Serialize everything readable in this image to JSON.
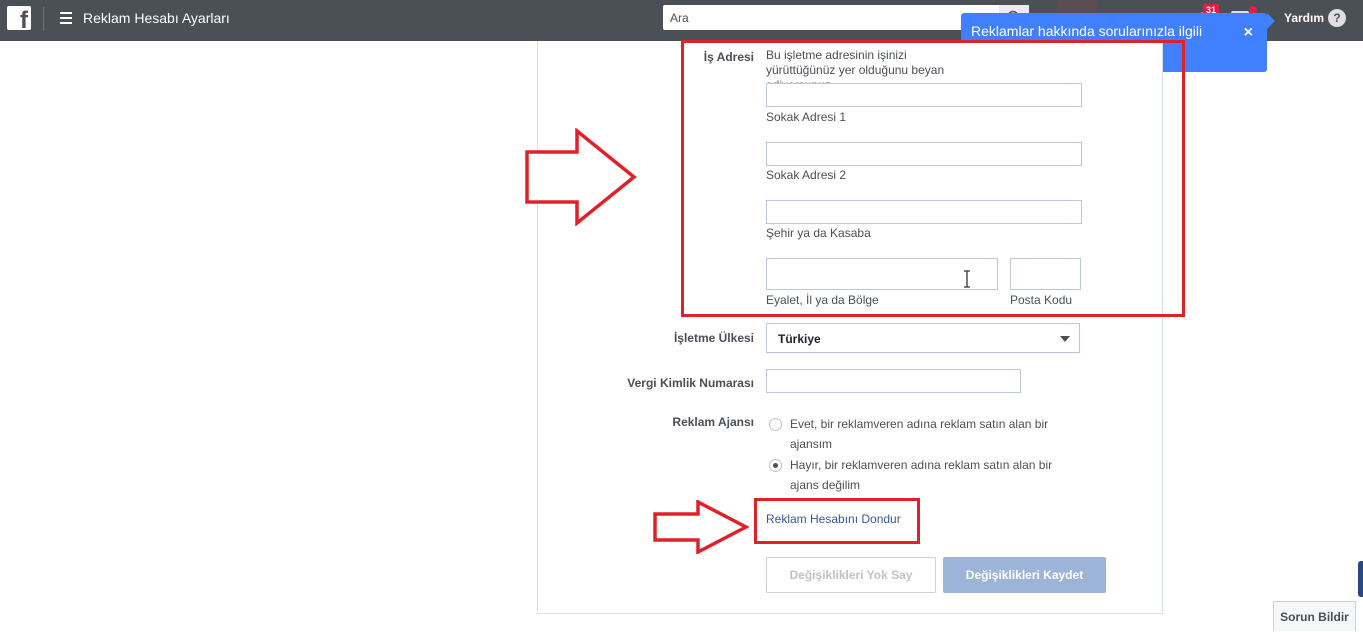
{
  "topbar": {
    "title": "Reklam Hesabı Ayarları",
    "search_placeholder": "Ara",
    "notif_badge": "31",
    "help_label": "Yardım",
    "help_icon": "?"
  },
  "tooltip": {
    "text": "Reklamlar hakkında sorularınızla ilgili yardım alın.",
    "close": "×"
  },
  "form": {
    "address_label": "İş Adresi",
    "address_help": "Bu işletme adresinin işinizi yürüttüğünüz yer olduğunu beyan ediyorsunuz.",
    "street1_caption": "Sokak Adresi 1",
    "street2_caption": "Sokak Adresi 2",
    "city_caption": "Şehir ya da Kasaba",
    "state_caption": "Eyalet, İl ya da Bölge",
    "zip_caption": "Posta Kodu",
    "country_label": "İşletme Ülkesi",
    "country_value": "Türkiye",
    "tax_label": "Vergi Kimlik Numarası",
    "agency_label": "Reklam Ajansı",
    "agency_yes": "Evet, bir reklamveren adına reklam satın alan bir ajansım",
    "agency_no": "Hayır, bir reklamveren adına reklam satın alan bir ajans değilim",
    "agency_selected": "no",
    "deactivate_link": "Reklam Hesabını Dondur",
    "cancel_button": "Değişiklikleri Yok Say",
    "save_button": "Değişiklikleri Kaydet"
  },
  "footer": {
    "report_button": "Sorun Bildir"
  },
  "colors": {
    "topbar": "#4b4f56",
    "tooltip": "#4080ff",
    "highlight": "#e02129",
    "link": "#365899"
  }
}
